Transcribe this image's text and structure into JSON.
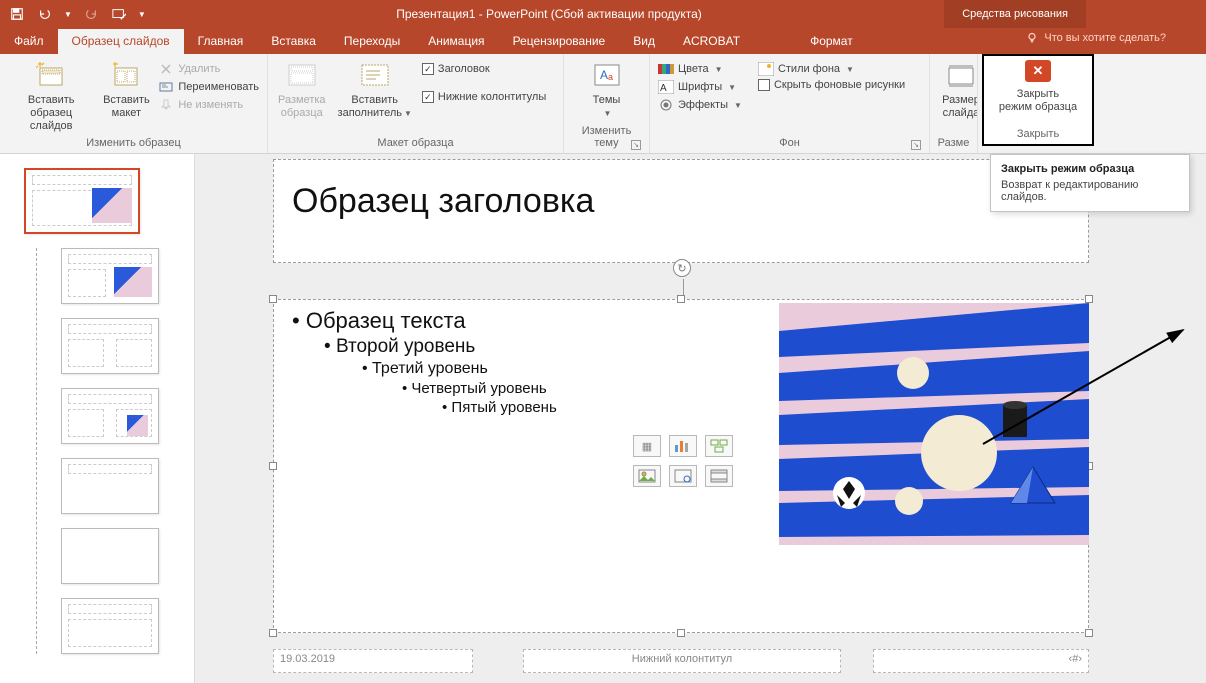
{
  "titlebar": {
    "title": "Презентация1 - PowerPoint (Сбой активации продукта)",
    "tool_tab": "Средства рисования"
  },
  "tabs": {
    "file": "Файл",
    "slide_master": "Образец слайдов",
    "home": "Главная",
    "insert": "Вставка",
    "transitions": "Переходы",
    "animation": "Анимация",
    "review": "Рецензирование",
    "view": "Вид",
    "acrobat": "ACROBAT",
    "format": "Формат",
    "tell_me": "Что вы хотите сделать?"
  },
  "ribbon": {
    "edit_master": {
      "insert_slide_master": "Вставить\nобразец слайдов",
      "insert_layout": "Вставить\nмакет",
      "delete": "Удалить",
      "rename": "Переименовать",
      "preserve": "Не изменять",
      "group_label": "Изменить образец"
    },
    "master_layout": {
      "master_layout": "Разметка\nобразца",
      "insert_placeholder": "Вставить\nзаполнитель",
      "title_cb": "Заголовок",
      "footers_cb": "Нижние колонтитулы",
      "group_label": "Макет образца"
    },
    "theme": {
      "themes": "Темы",
      "group_label": "Изменить тему"
    },
    "background": {
      "colors": "Цвета",
      "fonts": "Шрифты",
      "effects": "Эффекты",
      "bg_styles": "Стили фона",
      "hide_bg": "Скрыть фоновые рисунки",
      "group_label": "Фон"
    },
    "size": {
      "slide_size": "Размер\nслайда",
      "group_label": "Разме"
    },
    "close": {
      "close_master": "Закрыть\nрежим образца",
      "group_label": "Закрыть"
    }
  },
  "tooltip": {
    "title": "Закрыть режим образца",
    "body": "Возврат к редактированию слайдов."
  },
  "slide": {
    "title_ph": "Образец заголовка",
    "bullets": {
      "l1": "Образец текста",
      "l2": "Второй уровень",
      "l3": "Третий уровень",
      "l4": "Четвертый уровень",
      "l5": "Пятый уровень"
    },
    "footer_date": "19.03.2019",
    "footer_center": "Нижний колонтитул",
    "footer_num": "‹#›"
  }
}
